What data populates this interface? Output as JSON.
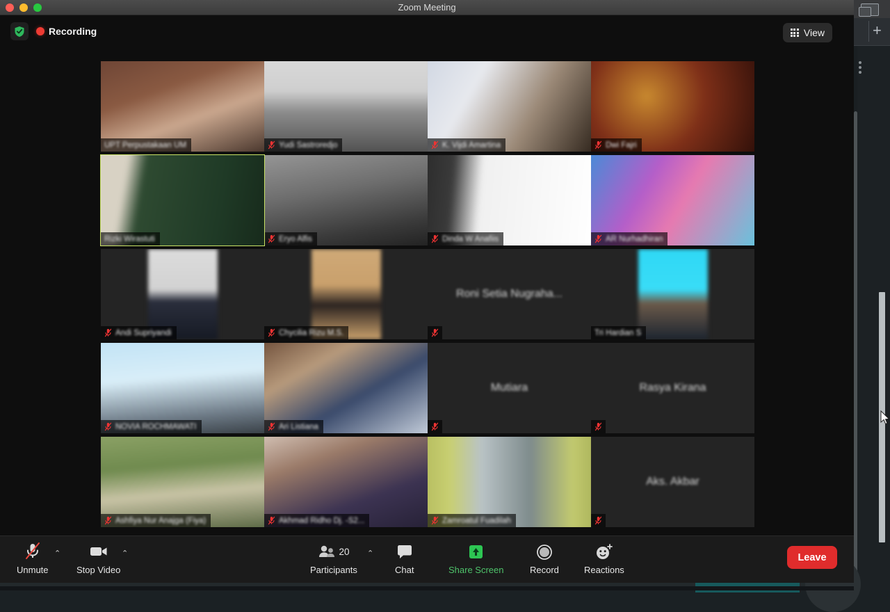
{
  "window": {
    "title": "Zoom Meeting",
    "traffic_lights": [
      "close",
      "minimize",
      "maximize"
    ]
  },
  "topbar": {
    "shield_icon": "shield-check-icon",
    "recording_label": "Recording",
    "recording_dot_color": "#ee3b33",
    "view_button": {
      "label": "View",
      "icon": "grid-icon"
    }
  },
  "gallery": {
    "active_border_color": "#c9e265",
    "columns": 4,
    "rows": 5,
    "tiles": [
      {
        "name": "UPT Perpustakaan UM",
        "muted": false,
        "name_blurred": true,
        "kind": "video",
        "label_pos": "bar",
        "active": false,
        "style": "brick"
      },
      {
        "name": "Yudi Sastroredjo",
        "muted": true,
        "name_blurred": true,
        "kind": "video",
        "label_pos": "bar",
        "active": false,
        "style": "grayroom"
      },
      {
        "name": "K. Vijdi Amartina",
        "muted": true,
        "name_blurred": true,
        "kind": "video",
        "label_pos": "bar",
        "active": false,
        "style": "door"
      },
      {
        "name": "Dwi Fajri",
        "muted": true,
        "name_blurred": true,
        "kind": "video",
        "label_pos": "bar",
        "active": false,
        "style": "warmroom"
      },
      {
        "name": "Rizki Wirastuti",
        "muted": false,
        "name_blurred": true,
        "kind": "video",
        "label_pos": "bar",
        "active": true,
        "style": "greencurtain"
      },
      {
        "name": "Eryo Alfis",
        "muted": true,
        "name_blurred": true,
        "kind": "video",
        "label_pos": "bar",
        "active": false,
        "style": "darkgray"
      },
      {
        "name": "Dinda W Anafiis",
        "muted": true,
        "name_blurred": true,
        "kind": "video",
        "label_pos": "bar",
        "active": false,
        "style": "whitewall"
      },
      {
        "name": "AR Nurhadhiran",
        "muted": true,
        "name_blurred": true,
        "kind": "video",
        "label_pos": "bar",
        "active": false,
        "style": "pinksky"
      },
      {
        "name": "Andi Supriyandi",
        "muted": true,
        "name_blurred": true,
        "kind": "photo",
        "label_pos": "bar",
        "active": false,
        "style": "suitphoto"
      },
      {
        "name": "Chycilia Rizu M.S.",
        "muted": true,
        "name_blurred": true,
        "kind": "photo",
        "label_pos": "bar",
        "active": false,
        "style": "tanphoto"
      },
      {
        "name": "Roni Setia Nugraha...",
        "muted": true,
        "name_blurred": true,
        "kind": "name-only",
        "label_pos": "center",
        "active": false,
        "style": "blank"
      },
      {
        "name": "Tri Hardian S",
        "muted": false,
        "name_blurred": true,
        "kind": "photo",
        "label_pos": "bar",
        "active": false,
        "style": "cyanphoto"
      },
      {
        "name": "NOVIA ROCHMAWATI",
        "muted": true,
        "name_blurred": true,
        "kind": "video",
        "label_pos": "bar",
        "active": false,
        "style": "skyposter"
      },
      {
        "name": "Ari Listiana",
        "muted": true,
        "name_blurred": true,
        "kind": "video",
        "label_pos": "bar",
        "active": false,
        "style": "shelves"
      },
      {
        "name": "Mutiara",
        "muted": true,
        "name_blurred": true,
        "kind": "name-only",
        "label_pos": "center",
        "active": false,
        "style": "blank"
      },
      {
        "name": "Rasya Kirana",
        "muted": true,
        "name_blurred": true,
        "kind": "name-only",
        "label_pos": "center",
        "active": false,
        "style": "blank"
      },
      {
        "name": "Ashfiya Nur Anajga (Fiya)",
        "muted": true,
        "name_blurred": true,
        "kind": "video",
        "label_pos": "bar",
        "active": false,
        "style": "forest"
      },
      {
        "name": "Akhmad Ridho Dj. -S2...",
        "muted": true,
        "name_blurred": true,
        "kind": "video",
        "label_pos": "bar",
        "active": false,
        "style": "maskroom"
      },
      {
        "name": "Zamroatul Fuadilah",
        "muted": true,
        "name_blurred": true,
        "kind": "video",
        "label_pos": "bar",
        "active": false,
        "style": "tent"
      },
      {
        "name": "Aks. Akbar",
        "muted": true,
        "name_blurred": true,
        "kind": "name-only",
        "label_pos": "center",
        "active": false,
        "style": "blank"
      }
    ]
  },
  "toolbar": {
    "mute": {
      "label": "Unmute",
      "icon": "mic-muted-icon",
      "has_caret": true
    },
    "video": {
      "label": "Stop Video",
      "icon": "video-camera-icon",
      "has_caret": true
    },
    "participants": {
      "label": "Participants",
      "count": "20",
      "icon": "participants-icon",
      "has_caret": true
    },
    "chat": {
      "label": "Chat",
      "icon": "chat-bubble-icon"
    },
    "share": {
      "label": "Share Screen",
      "icon": "share-screen-icon",
      "color": "#4ec26a"
    },
    "record": {
      "label": "Record",
      "icon": "record-circle-icon"
    },
    "reactions": {
      "label": "Reactions",
      "icon": "reactions-smiley-icon"
    },
    "leave": {
      "label": "Leave",
      "color": "#e02c2c"
    }
  },
  "background": {
    "browser_plus": "+",
    "tab_switcher_icon": "tab-switcher-icon",
    "kebab_icon": "more-vertical-icon",
    "cursor": "mouse-cursor"
  }
}
